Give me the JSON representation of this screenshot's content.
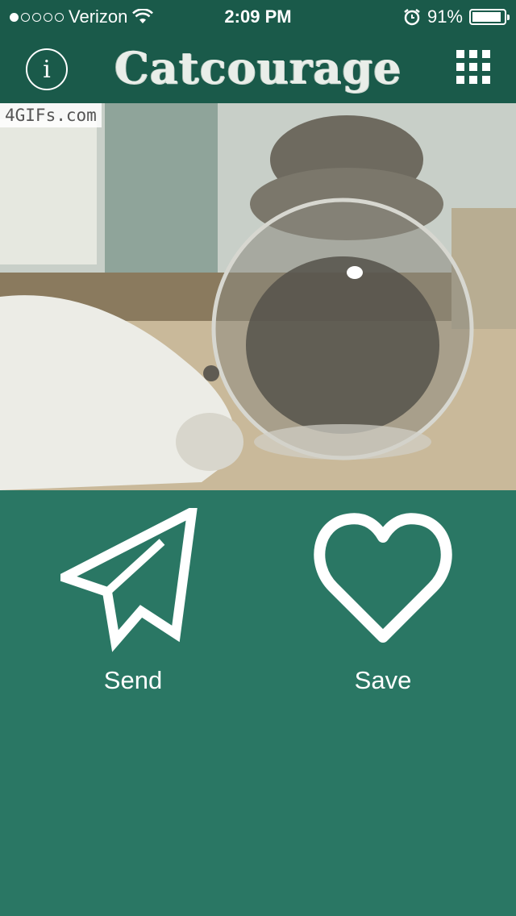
{
  "status_bar": {
    "carrier": "Verizon",
    "time": "2:09 PM",
    "battery": "91%",
    "signal_dots_filled": 1,
    "signal_dots_total": 5,
    "battery_level": 0.91
  },
  "header": {
    "title": "Catcourage",
    "info_label": "i",
    "info_icon": "info-icon",
    "menu_icon": "grid-menu-icon"
  },
  "media": {
    "watermark": "4GIFs.com"
  },
  "actions": {
    "send_label": "Send",
    "send_icon": "paper-plane-icon",
    "save_label": "Save",
    "save_icon": "heart-icon"
  },
  "colors": {
    "header_bg": "#1a5a4a",
    "page_bg": "#2a7764",
    "icon": "#ffffff"
  }
}
